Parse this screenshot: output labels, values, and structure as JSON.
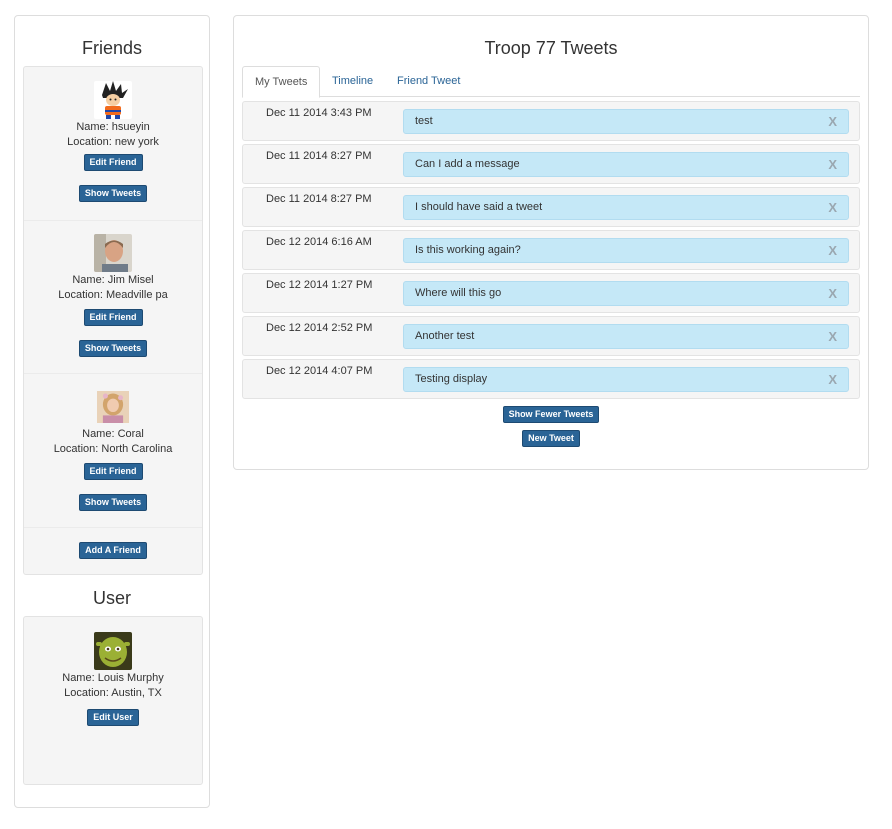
{
  "friends": {
    "title": "Friends",
    "items": [
      {
        "name": "Name: hsueyin",
        "location": "Location: new york",
        "edit": "Edit Friend",
        "show": "Show Tweets"
      },
      {
        "name": "Name: Jim Misel",
        "location": "Location: Meadville pa",
        "edit": "Edit Friend",
        "show": "Show Tweets"
      },
      {
        "name": "Name: Coral",
        "location": "Location: North Carolina",
        "edit": "Edit Friend",
        "show": "Show Tweets"
      }
    ],
    "add_label": "Add A Friend"
  },
  "user": {
    "title": "User",
    "name": "Name: Louis Murphy",
    "location": "Location: Austin, TX",
    "edit": "Edit User"
  },
  "main": {
    "title": "Troop 77 Tweets",
    "tabs": [
      {
        "label": "My Tweets"
      },
      {
        "label": "Timeline"
      },
      {
        "label": "Friend Tweet"
      }
    ],
    "tweets": [
      {
        "date": "Dec 11 2014 3:43 PM",
        "text": "test",
        "delete": "X"
      },
      {
        "date": "Dec 11 2014 8:27 PM",
        "text": "Can I add a message",
        "delete": "X"
      },
      {
        "date": "Dec 11 2014 8:27 PM",
        "text": "I should have said a tweet",
        "delete": "X"
      },
      {
        "date": "Dec 12 2014 6:16 AM",
        "text": "Is this working again?",
        "delete": "X"
      },
      {
        "date": "Dec 12 2014 1:27 PM",
        "text": "Where will this go",
        "delete": "X"
      },
      {
        "date": "Dec 12 2014 2:52 PM",
        "text": "Another test",
        "delete": "X"
      },
      {
        "date": "Dec 12 2014 4:07 PM",
        "text": "Testing display",
        "delete": "X"
      }
    ],
    "show_fewer": "Show Fewer Tweets",
    "new_tweet": "New Tweet"
  }
}
